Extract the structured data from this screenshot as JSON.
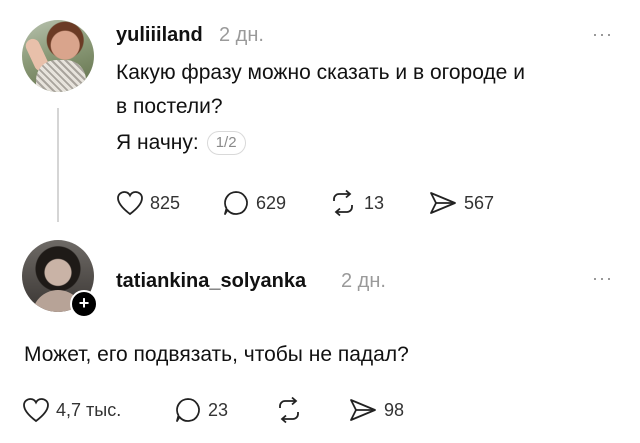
{
  "posts": [
    {
      "username": "yuliiiland",
      "time": "2 дн.",
      "more": "···",
      "text_line1": "Какую фразу можно сказать и в огороде и",
      "text_line2": "в постели?",
      "text_line3": "Я начну:",
      "pager": "1/2",
      "likes": "825",
      "comments": "629",
      "reposts": "13",
      "shares": "567"
    },
    {
      "username": "tatiankina_solyanka",
      "time": "2 дн.",
      "more": "···",
      "text": "Может, его подвязать, чтобы не падал?",
      "likes": "4,7 тыс.",
      "comments": "23",
      "reposts": "",
      "shares": "98",
      "follow": "+"
    }
  ],
  "icons": [
    "heart-icon",
    "comment-icon",
    "repost-icon",
    "share-icon",
    "more-icon",
    "follow-plus-icon"
  ]
}
